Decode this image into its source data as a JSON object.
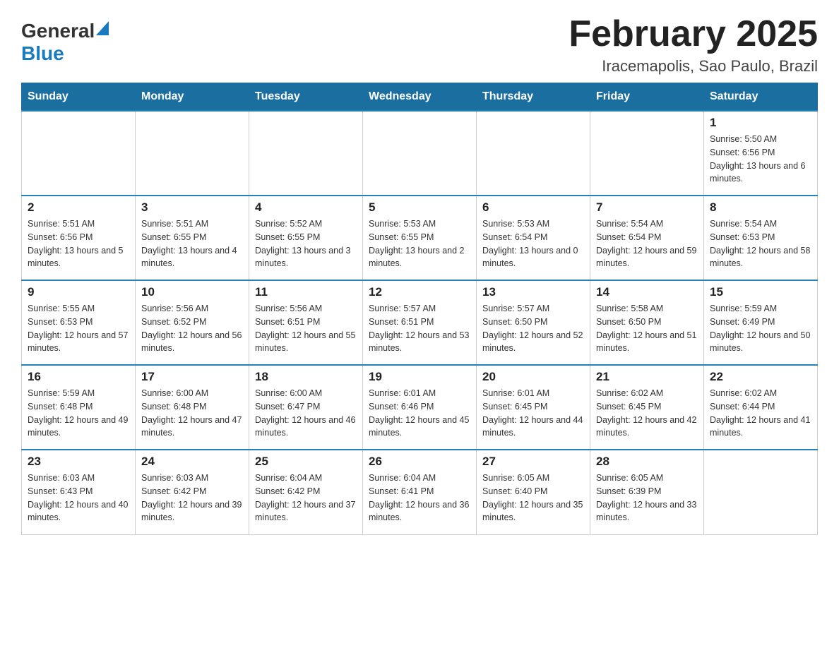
{
  "header": {
    "logo_general": "General",
    "logo_blue": "Blue",
    "month_title": "February 2025",
    "location": "Iracemapolis, Sao Paulo, Brazil"
  },
  "days_of_week": [
    "Sunday",
    "Monday",
    "Tuesday",
    "Wednesday",
    "Thursday",
    "Friday",
    "Saturday"
  ],
  "weeks": [
    [
      {
        "day": "",
        "info": ""
      },
      {
        "day": "",
        "info": ""
      },
      {
        "day": "",
        "info": ""
      },
      {
        "day": "",
        "info": ""
      },
      {
        "day": "",
        "info": ""
      },
      {
        "day": "",
        "info": ""
      },
      {
        "day": "1",
        "info": "Sunrise: 5:50 AM\nSunset: 6:56 PM\nDaylight: 13 hours and 6 minutes."
      }
    ],
    [
      {
        "day": "2",
        "info": "Sunrise: 5:51 AM\nSunset: 6:56 PM\nDaylight: 13 hours and 5 minutes."
      },
      {
        "day": "3",
        "info": "Sunrise: 5:51 AM\nSunset: 6:55 PM\nDaylight: 13 hours and 4 minutes."
      },
      {
        "day": "4",
        "info": "Sunrise: 5:52 AM\nSunset: 6:55 PM\nDaylight: 13 hours and 3 minutes."
      },
      {
        "day": "5",
        "info": "Sunrise: 5:53 AM\nSunset: 6:55 PM\nDaylight: 13 hours and 2 minutes."
      },
      {
        "day": "6",
        "info": "Sunrise: 5:53 AM\nSunset: 6:54 PM\nDaylight: 13 hours and 0 minutes."
      },
      {
        "day": "7",
        "info": "Sunrise: 5:54 AM\nSunset: 6:54 PM\nDaylight: 12 hours and 59 minutes."
      },
      {
        "day": "8",
        "info": "Sunrise: 5:54 AM\nSunset: 6:53 PM\nDaylight: 12 hours and 58 minutes."
      }
    ],
    [
      {
        "day": "9",
        "info": "Sunrise: 5:55 AM\nSunset: 6:53 PM\nDaylight: 12 hours and 57 minutes."
      },
      {
        "day": "10",
        "info": "Sunrise: 5:56 AM\nSunset: 6:52 PM\nDaylight: 12 hours and 56 minutes."
      },
      {
        "day": "11",
        "info": "Sunrise: 5:56 AM\nSunset: 6:51 PM\nDaylight: 12 hours and 55 minutes."
      },
      {
        "day": "12",
        "info": "Sunrise: 5:57 AM\nSunset: 6:51 PM\nDaylight: 12 hours and 53 minutes."
      },
      {
        "day": "13",
        "info": "Sunrise: 5:57 AM\nSunset: 6:50 PM\nDaylight: 12 hours and 52 minutes."
      },
      {
        "day": "14",
        "info": "Sunrise: 5:58 AM\nSunset: 6:50 PM\nDaylight: 12 hours and 51 minutes."
      },
      {
        "day": "15",
        "info": "Sunrise: 5:59 AM\nSunset: 6:49 PM\nDaylight: 12 hours and 50 minutes."
      }
    ],
    [
      {
        "day": "16",
        "info": "Sunrise: 5:59 AM\nSunset: 6:48 PM\nDaylight: 12 hours and 49 minutes."
      },
      {
        "day": "17",
        "info": "Sunrise: 6:00 AM\nSunset: 6:48 PM\nDaylight: 12 hours and 47 minutes."
      },
      {
        "day": "18",
        "info": "Sunrise: 6:00 AM\nSunset: 6:47 PM\nDaylight: 12 hours and 46 minutes."
      },
      {
        "day": "19",
        "info": "Sunrise: 6:01 AM\nSunset: 6:46 PM\nDaylight: 12 hours and 45 minutes."
      },
      {
        "day": "20",
        "info": "Sunrise: 6:01 AM\nSunset: 6:45 PM\nDaylight: 12 hours and 44 minutes."
      },
      {
        "day": "21",
        "info": "Sunrise: 6:02 AM\nSunset: 6:45 PM\nDaylight: 12 hours and 42 minutes."
      },
      {
        "day": "22",
        "info": "Sunrise: 6:02 AM\nSunset: 6:44 PM\nDaylight: 12 hours and 41 minutes."
      }
    ],
    [
      {
        "day": "23",
        "info": "Sunrise: 6:03 AM\nSunset: 6:43 PM\nDaylight: 12 hours and 40 minutes."
      },
      {
        "day": "24",
        "info": "Sunrise: 6:03 AM\nSunset: 6:42 PM\nDaylight: 12 hours and 39 minutes."
      },
      {
        "day": "25",
        "info": "Sunrise: 6:04 AM\nSunset: 6:42 PM\nDaylight: 12 hours and 37 minutes."
      },
      {
        "day": "26",
        "info": "Sunrise: 6:04 AM\nSunset: 6:41 PM\nDaylight: 12 hours and 36 minutes."
      },
      {
        "day": "27",
        "info": "Sunrise: 6:05 AM\nSunset: 6:40 PM\nDaylight: 12 hours and 35 minutes."
      },
      {
        "day": "28",
        "info": "Sunrise: 6:05 AM\nSunset: 6:39 PM\nDaylight: 12 hours and 33 minutes."
      },
      {
        "day": "",
        "info": ""
      }
    ]
  ]
}
